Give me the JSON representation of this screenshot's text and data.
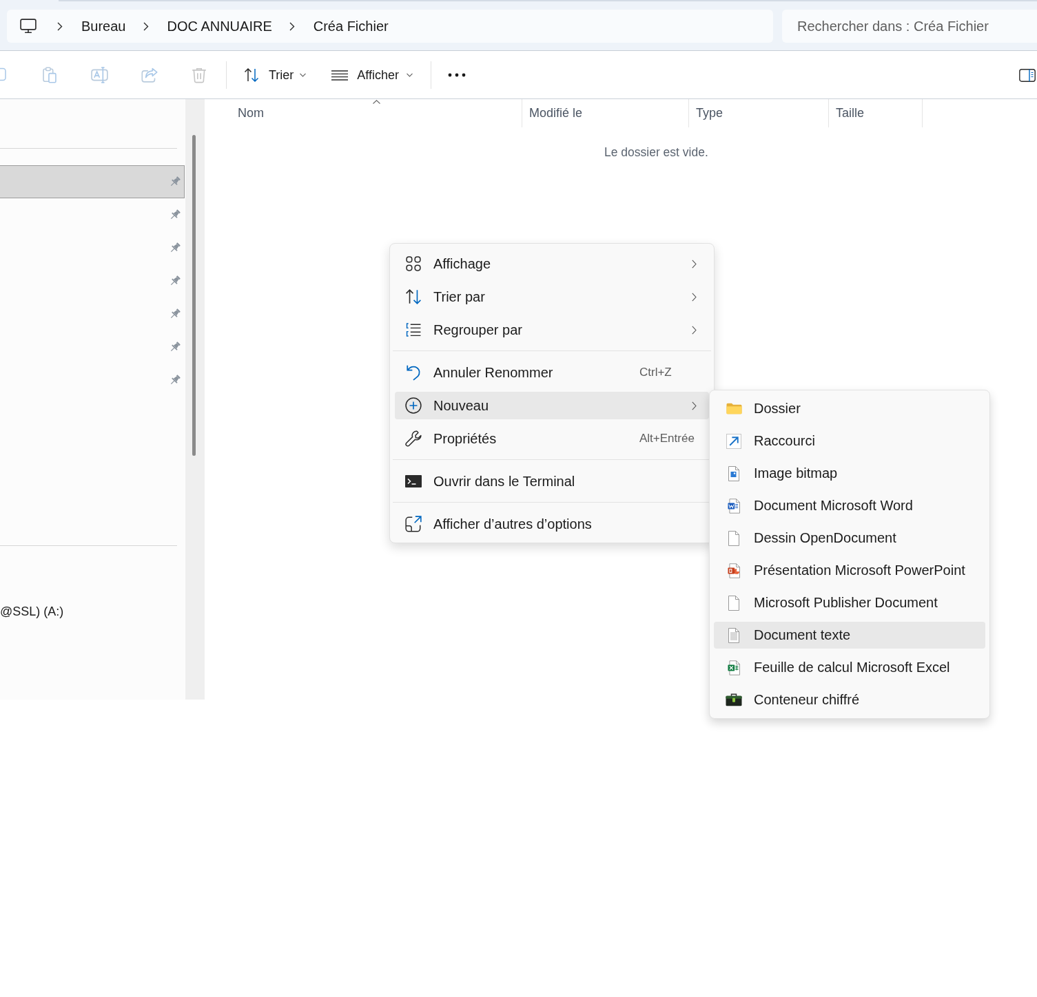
{
  "address_bar": {
    "breadcrumbs": [
      "Bureau",
      "DOC ANNUAIRE",
      "Créa Fichier"
    ]
  },
  "search": {
    "placeholder": "Rechercher dans : Créa Fichier"
  },
  "toolbar": {
    "icon_buttons": [
      {
        "disabled": true
      },
      {
        "disabled": true
      },
      {
        "disabled": true
      },
      {
        "disabled": true
      },
      {
        "disabled": true
      }
    ],
    "sort_button": {
      "label": "Trier"
    },
    "view_button": {
      "label": "Afficher"
    }
  },
  "sidebar": {
    "pinned_items": [
      {
        "selected": true
      },
      {
        "selected": false
      },
      {
        "selected": false
      },
      {
        "selected": false
      },
      {
        "selected": false
      },
      {
        "selected": false
      },
      {
        "selected": false
      }
    ],
    "drive_items": [
      {
        "label": "@SSL) (A:)"
      }
    ]
  },
  "file_list": {
    "columns": [
      {
        "label": "Nom",
        "sorted": true
      },
      {
        "label": "Modifié le",
        "sorted": false
      },
      {
        "label": "Type",
        "sorted": false
      },
      {
        "label": "Taille",
        "sorted": false
      }
    ],
    "empty_message": "Le dossier est vide."
  },
  "context_menu": {
    "groups": [
      [
        {
          "label": "Affichage",
          "submenu": true,
          "highlighted": false
        },
        {
          "label": "Trier par",
          "submenu": true,
          "highlighted": false
        },
        {
          "label": "Regrouper par",
          "submenu": true,
          "highlighted": false
        }
      ],
      [
        {
          "label": "Annuler Renommer",
          "shortcut": "Ctrl+Z",
          "submenu": false,
          "highlighted": false
        },
        {
          "label": "Nouveau",
          "submenu": true,
          "highlighted": true
        },
        {
          "label": "Propriétés",
          "shortcut": "Alt+Entrée",
          "submenu": false,
          "highlighted": false
        }
      ],
      [
        {
          "label": "Ouvrir dans le Terminal",
          "submenu": false,
          "highlighted": false
        }
      ],
      [
        {
          "label": "Afficher d’autres d’options",
          "submenu": false,
          "highlighted": false
        }
      ]
    ]
  },
  "new_submenu": {
    "items": [
      {
        "label": "Dossier",
        "highlighted": false
      },
      {
        "label": "Raccourci",
        "highlighted": false
      },
      {
        "label": "Image bitmap",
        "highlighted": false
      },
      {
        "label": "Document Microsoft Word",
        "highlighted": false
      },
      {
        "label": "Dessin OpenDocument",
        "highlighted": false
      },
      {
        "label": "Présentation Microsoft PowerPoint",
        "highlighted": false
      },
      {
        "label": "Microsoft Publisher Document",
        "highlighted": false
      },
      {
        "label": "Document texte",
        "highlighted": true
      },
      {
        "label": "Feuille de calcul Microsoft Excel",
        "highlighted": false
      },
      {
        "label": "Conteneur chiffré",
        "highlighted": false
      }
    ]
  }
}
